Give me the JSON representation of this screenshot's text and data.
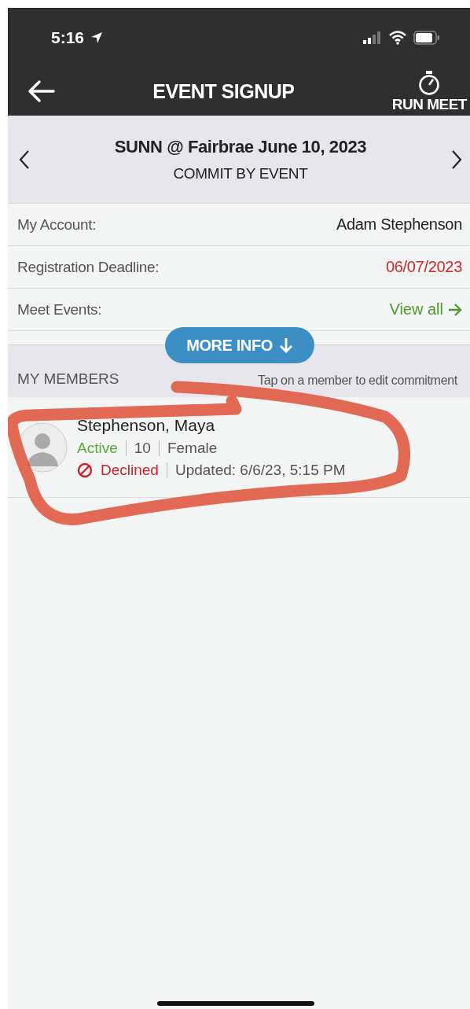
{
  "status_bar": {
    "time": "5:16"
  },
  "header": {
    "title": "EVENT SIGNUP",
    "action": "RUN MEET"
  },
  "event": {
    "title": "SUNN @ Fairbrae June 10, 2023",
    "subtitle": "COMMIT BY EVENT"
  },
  "info_rows": [
    {
      "label": "My Account:",
      "value": "Adam Stephenson",
      "kind": "plain"
    },
    {
      "label": "Registration Deadline:",
      "value": "06/07/2023",
      "kind": "alert"
    },
    {
      "label": "Meet Events:",
      "value": "View all",
      "kind": "link"
    }
  ],
  "more_info": "MORE INFO",
  "members_section": {
    "title": "MY MEMBERS",
    "hint": "Tap on a member to edit commitment"
  },
  "members": [
    {
      "name": "Stephenson, Maya",
      "status": "Active",
      "age": "10",
      "gender": "Female",
      "commitment": {
        "label": "Declined",
        "kind": "declined"
      },
      "updated": "Updated: 6/6/23, 5:15 PM"
    }
  ]
}
